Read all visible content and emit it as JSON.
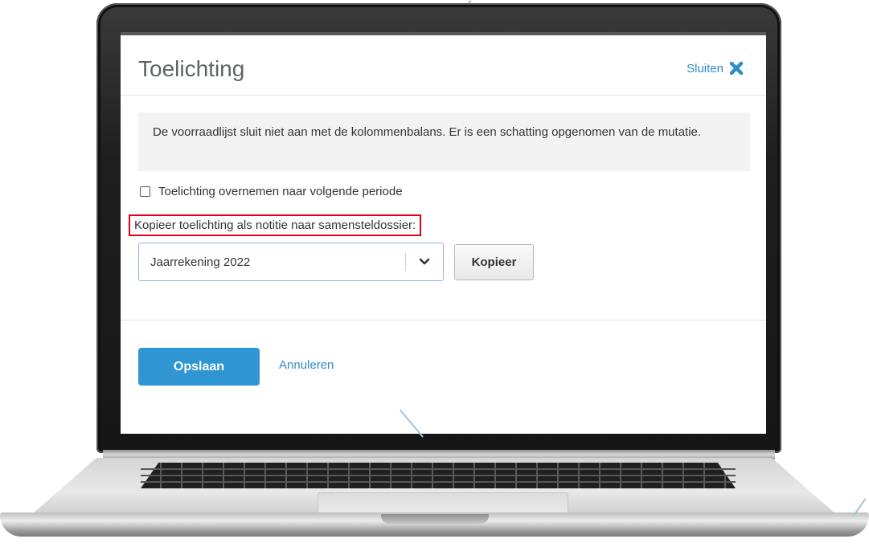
{
  "dialog": {
    "title": "Toelichting",
    "close_label": "Sluiten",
    "note_text": "De voorraadlijst sluit niet aan met de kolommenbalans. Er is een schatting opgenomen van de mutatie.",
    "carry_over": {
      "label": "Toelichting overnemen naar volgende periode",
      "checked": false
    },
    "copy_label": "Kopieer toelichting als notitie naar samensteldossier:",
    "dossier_select": {
      "selected": "Jaarrekening 2022"
    },
    "copy_button": "Kopieer",
    "save_button": "Opslaan",
    "cancel_link": "Annuleren"
  },
  "colors": {
    "accent": "#2f96d3",
    "link": "#2e8cc7",
    "highlight_border": "#e0001b"
  },
  "icons": {
    "close": "close-icon",
    "dropdown": "chevron-down-icon"
  }
}
